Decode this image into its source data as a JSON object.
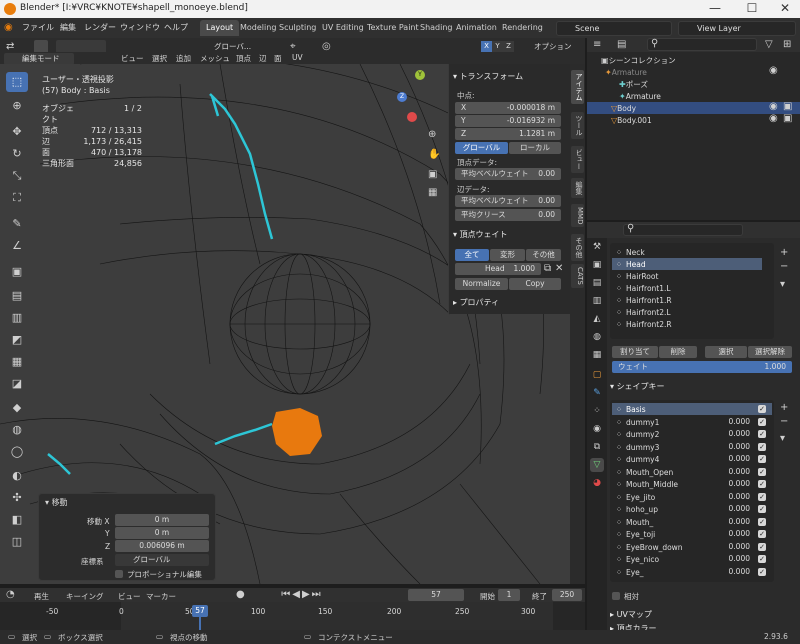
{
  "titlebar": {
    "title": "Blender* [I:¥VRC¥KNOTE¥shapell_monoeye.blend]",
    "minimize": "—",
    "maximize": "☐",
    "close": "✕"
  },
  "menubar": {
    "items": [
      "ファイル",
      "編集",
      "レンダー",
      "ウィンドウ",
      "ヘルプ"
    ],
    "tabs": [
      "Layout",
      "Modeling",
      "Sculpting",
      "UV Editing",
      "Texture Paint",
      "Shading",
      "Animation",
      "Rendering"
    ],
    "scene": "Scene",
    "view_layer": "View Layer"
  },
  "viewport_header": {
    "orientation": "グローバ...",
    "mode": "編集モード",
    "menus": [
      "ビュー",
      "選択",
      "追加",
      "メッシュ",
      "頂点",
      "辺",
      "面",
      "UV"
    ],
    "axes": [
      "X",
      "Y",
      "Z"
    ],
    "options": "オプション"
  },
  "stats": {
    "view": "ユーザー・透視投影",
    "object_line": "(57) Body : Basis",
    "rows": [
      {
        "k": "オブジェクト",
        "v": "1 / 2"
      },
      {
        "k": "頂点",
        "v": "712 / 13,313"
      },
      {
        "k": "辺",
        "v": "1,173 / 26,415"
      },
      {
        "k": "面",
        "v": "470 / 13,178"
      },
      {
        "k": "三角形面",
        "v": "24,856"
      }
    ]
  },
  "npanel": {
    "transform_title": "トランスフォーム",
    "median": "中点:",
    "x": {
      "k": "X",
      "v": "-0.000018 m"
    },
    "y": {
      "k": "Y",
      "v": "-0.016932 m"
    },
    "z": {
      "k": "Z",
      "v": "1.1281 m"
    },
    "global": "グローバル",
    "local": "ローカル",
    "vertex_data": "頂点データ:",
    "mean_bevel_weight": "平均ベベルウェイト",
    "mean_bevel_value": "0.00",
    "edge_data": "辺データ:",
    "edge_bevel_weight": "平均ベベルウェイト",
    "edge_bevel_value": "0.00",
    "mean_crease": "平均クリース",
    "mean_crease_value": "0.00",
    "vertex_weights_title": "頂点ウェイト",
    "all": "全て",
    "deform": "変形",
    "other": "その他",
    "head_label": "Head",
    "head_value": "1.000",
    "normalize": "Normalize",
    "copy": "Copy",
    "properties": "プロパティ"
  },
  "vtabs": [
    "アイテム",
    "ツール",
    "ビュー",
    "編集",
    "MMD",
    "その他",
    "CATS"
  ],
  "redo": {
    "title": "移動",
    "move_x_label": "移動 X",
    "move_x": "0 m",
    "y_label": "Y",
    "y": "0 m",
    "z_label": "Z",
    "z": "0.006096 m",
    "orient_label": "座標系",
    "orient": "グローバル",
    "proportional": "プロポーショナル編集"
  },
  "timeline": {
    "playback": "再生",
    "keying": "キーイング",
    "view": "ビュー",
    "marker": "マーカー",
    "current": "57",
    "start_label": "開始",
    "start": "1",
    "end_label": "終了",
    "end": "250",
    "ticks": [
      "-50",
      "0",
      "50",
      "100",
      "150",
      "200",
      "250",
      "300"
    ],
    "playhead": "57"
  },
  "statusbar": {
    "select": "選択",
    "box_select": "ボックス選択",
    "rotate_view": "視点の移動",
    "context_menu": "コンテクストメニュー",
    "version": "2.93.6"
  },
  "outliner": {
    "rows": [
      {
        "label": "シーンコレクション"
      },
      {
        "label": "Armature"
      },
      {
        "label": "ポーズ"
      },
      {
        "label": "Armature"
      },
      {
        "label": "Body"
      },
      {
        "label": "Body.001"
      }
    ]
  },
  "vertex_groups": {
    "items": [
      "Neck",
      "Head",
      "HairRoot",
      "Hairfront1.L",
      "Hairfront1.R",
      "Hairfront2.L",
      "Hairfront2.R"
    ],
    "assign": "割り当て",
    "remove": "削除",
    "select": "選択",
    "deselect": "選択解除",
    "weight_label": "ウェイト",
    "weight_value": "1.000"
  },
  "shape_keys": {
    "title": "シェイプキー",
    "items": [
      {
        "name": "Basis",
        "value": ""
      },
      {
        "name": "dummy1",
        "value": "0.000"
      },
      {
        "name": "dummy2",
        "value": "0.000"
      },
      {
        "name": "dummy3",
        "value": "0.000"
      },
      {
        "name": "dummy4",
        "value": "0.000"
      },
      {
        "name": "Mouth_Open",
        "value": "0.000"
      },
      {
        "name": "Mouth_Middle",
        "value": "0.000"
      },
      {
        "name": "Eye_jito",
        "value": "0.000"
      },
      {
        "name": "hoho_up",
        "value": "0.000"
      },
      {
        "name": "Mouth_",
        "value": "0.000"
      },
      {
        "name": "Eye_toji",
        "value": "0.000"
      },
      {
        "name": "EyeBrow_down",
        "value": "0.000"
      },
      {
        "name": "Eye_nico",
        "value": "0.000"
      },
      {
        "name": "Eye_",
        "value": "0.000"
      }
    ],
    "relative": "相対",
    "uvmap": "UVマップ",
    "vertex_color": "頂点カラー"
  },
  "colors": {
    "accent": "#4772b3",
    "selection": "#e8790e",
    "highlight": "#2dc6d6"
  }
}
